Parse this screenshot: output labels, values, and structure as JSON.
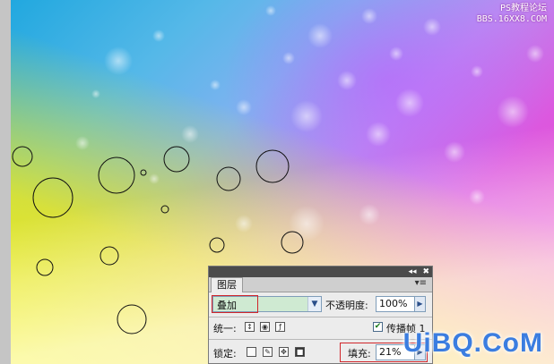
{
  "watermark": {
    "site_line1": "PS教程论坛",
    "site_line2": "BBS.16XX8.COM",
    "logo_text": "UiBQ.CoM"
  },
  "layers_panel": {
    "tab_label": "图层",
    "blend_mode": "叠加",
    "opacity_label": "不透明度:",
    "opacity_value": "100%",
    "unify_label": "统一:",
    "propagate_label": "传播帧 1",
    "propagate_checked": true,
    "lock_label": "锁定:",
    "fill_label": "填充:",
    "fill_value": "21%"
  },
  "colors": {
    "highlight_box": "#d0262a",
    "panel_titlebar": "#4b4b4b",
    "blend_field_bg": "#cfead2"
  }
}
